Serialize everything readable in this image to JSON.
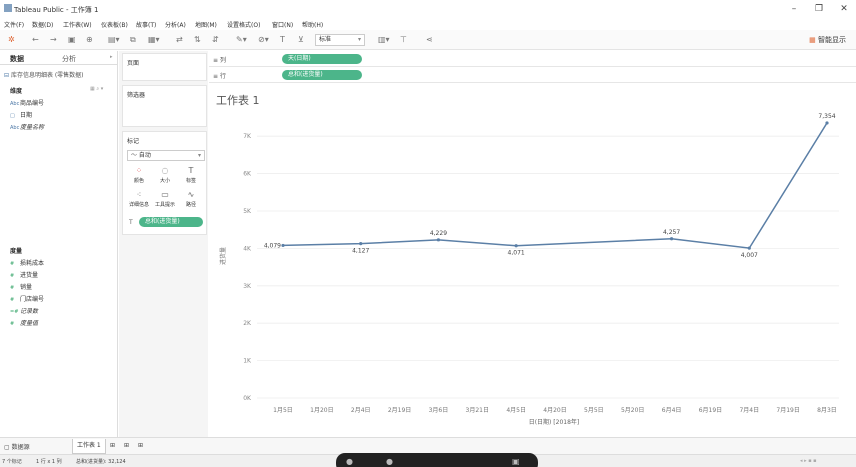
{
  "window": {
    "title": "Tableau Public - 工作簿 1",
    "min_icon": "minimize-icon",
    "max_icon": "maximize-icon",
    "close_icon": "close-icon"
  },
  "menu": [
    "文件(F)",
    "数据(D)",
    "工作表(W)",
    "仪表板(B)",
    "故事(T)",
    "分析(A)",
    "地图(M)",
    "设置格式(O)",
    "窗口(N)",
    "帮助(H)"
  ],
  "toolbar": {
    "fit_value": "标准",
    "smart_show": "智能显示"
  },
  "left_panel": {
    "tab_data": "数据",
    "tab_analysis": "分析",
    "datasource": "库存信息明细表 (零售数据)",
    "dimensions_label": "维度",
    "dimensions": [
      {
        "icon": "Abc",
        "name": "商品编号",
        "italic": false
      },
      {
        "icon": "□",
        "name": "日期",
        "italic": false
      },
      {
        "icon": "Abc",
        "name": "度量名称",
        "italic": true
      }
    ],
    "measures_label": "度量",
    "measures": [
      {
        "icon": "#",
        "name": "损耗成本",
        "italic": false
      },
      {
        "icon": "#",
        "name": "进货量",
        "italic": false
      },
      {
        "icon": "#",
        "name": "销量",
        "italic": false
      },
      {
        "icon": "#",
        "name": "门店编号",
        "italic": false
      },
      {
        "icon": "=#",
        "name": "记录数",
        "italic": true
      },
      {
        "icon": "#",
        "name": "度量值",
        "italic": true
      }
    ]
  },
  "mid_panel": {
    "pages_label": "页面",
    "filters_label": "筛选器",
    "marks_label": "标记",
    "mark_type": "自动",
    "mark_buttons": [
      {
        "icon": "color-icon",
        "glyph": "⁘",
        "label": "颜色"
      },
      {
        "icon": "size-icon",
        "glyph": "◌",
        "label": "大小"
      },
      {
        "icon": "label-icon",
        "glyph": "T",
        "label": "标签"
      },
      {
        "icon": "detail-icon",
        "glyph": "⁖",
        "label": "详细信息"
      },
      {
        "icon": "tooltip-icon",
        "glyph": "▭",
        "label": "工具提示"
      },
      {
        "icon": "path-icon",
        "glyph": "∿",
        "label": "路径"
      }
    ],
    "marks_pill": "总和(进货量)"
  },
  "shelves": {
    "columns_label": "列",
    "columns_pill": "天(日期)",
    "rows_label": "行",
    "rows_pill": "总和(进货量)"
  },
  "sheet_title": "工作表 1",
  "chart_data": {
    "type": "line",
    "x": [
      "1月5日",
      "1月20日",
      "2月4日",
      "2月19日",
      "3月6日",
      "3月21日",
      "4月5日",
      "4月20日",
      "5月5日",
      "5月20日",
      "6月4日",
      "6月19日",
      "7月4日",
      "7月19日",
      "8月3日"
    ],
    "points": [
      {
        "x": "1月5日",
        "y": 4079,
        "label": "4,079"
      },
      {
        "x": "2月4日",
        "y": 4127,
        "label": "4,127"
      },
      {
        "x": "3月6日",
        "y": 4229,
        "label": "4,229"
      },
      {
        "x": "4月5日",
        "y": 4071,
        "label": "4,071"
      },
      {
        "x": "6月4日",
        "y": 4257,
        "label": "4,257"
      },
      {
        "x": "7月4日",
        "y": 4007,
        "label": "4,007"
      },
      {
        "x": "8月3日",
        "y": 7354,
        "label": "7,354"
      }
    ],
    "yticks": [
      0,
      1000,
      2000,
      3000,
      4000,
      5000,
      6000,
      7000
    ],
    "ytick_labels": [
      "0K",
      "1K",
      "2K",
      "3K",
      "4K",
      "5K",
      "6K",
      "7K"
    ],
    "ylim": [
      0,
      7700
    ],
    "ylabel": "进货量",
    "xlabel": "日(日期) [2018年]",
    "color": "#5b7fa6",
    "grid": true
  },
  "bottom": {
    "datasource_tab": "数据源",
    "sheet_tab": "工作表 1"
  },
  "status": {
    "marks": "7 个标记",
    "rowscols": "1 行 x 1 列",
    "sum": "总和(进货量): 32,124"
  }
}
